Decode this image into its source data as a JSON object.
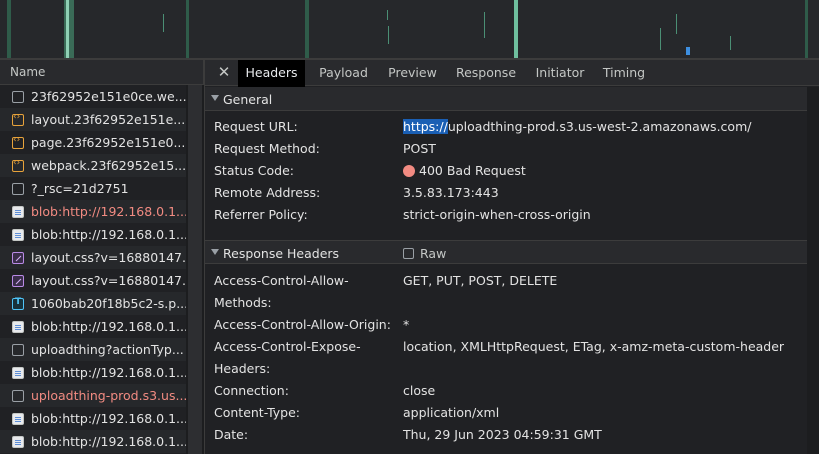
{
  "left_panel": {
    "header": "Name",
    "rows": [
      {
        "icon": "document-icon",
        "label": "23f62952e151e0ce.we...",
        "error": false
      },
      {
        "icon": "script-icon",
        "label": "layout.23f62952e151e...",
        "error": false
      },
      {
        "icon": "script-icon",
        "label": "page.23f62952e151e0...",
        "error": false
      },
      {
        "icon": "script-icon",
        "label": "webpack.23f62952e15...",
        "error": false
      },
      {
        "icon": "document-icon",
        "label": "?_rsc=21d2751",
        "error": false
      },
      {
        "icon": "blob-icon",
        "label": "blob:http://192.168.0.1...",
        "error": true
      },
      {
        "icon": "blob-icon",
        "label": "blob:http://192.168.0.1...",
        "error": false
      },
      {
        "icon": "stylesheet-icon",
        "label": "layout.css?v=16880147...",
        "error": false
      },
      {
        "icon": "stylesheet-icon",
        "label": "layout.css?v=16880147...",
        "error": false
      },
      {
        "icon": "font-icon",
        "label": "1060bab20f18b5c2-s.p...",
        "error": false
      },
      {
        "icon": "blob-icon",
        "label": "blob:http://192.168.0.1...",
        "error": false
      },
      {
        "icon": "document-icon",
        "label": "uploadthing?actionTyp...",
        "error": false
      },
      {
        "icon": "blob-icon",
        "label": "blob:http://192.168.0.1...",
        "error": false
      },
      {
        "icon": "document-icon",
        "label": "uploadthing-prod.s3.us...",
        "error": true
      },
      {
        "icon": "blob-icon",
        "label": "blob:http://192.168.0.1...",
        "error": false
      },
      {
        "icon": "blob-icon",
        "label": "blob:http://192.168.0.1...",
        "error": false
      }
    ]
  },
  "tabs": {
    "close_icon": "close-icon",
    "items": [
      "Headers",
      "Payload",
      "Preview",
      "Response",
      "Initiator",
      "Timing"
    ],
    "active": "Headers"
  },
  "general": {
    "title": "General",
    "request_url_label": "Request URL:",
    "request_url_selected": "https://",
    "request_url_rest": "uploadthing-prod.s3.us-west-2.amazonaws.com/",
    "request_method_label": "Request Method:",
    "request_method": "POST",
    "status_code_label": "Status Code:",
    "status_code": "400 Bad Request",
    "status_color": "#f28b82",
    "remote_address_label": "Remote Address:",
    "remote_address": "3.5.83.173:443",
    "referrer_policy_label": "Referrer Policy:",
    "referrer_policy": "strict-origin-when-cross-origin"
  },
  "response_headers": {
    "title": "Response Headers",
    "raw_label": "Raw",
    "raw_checked": false,
    "rows": [
      {
        "key_line1": "Access-Control-Allow-",
        "key_line2": "Methods:",
        "value": "GET, PUT, POST, DELETE"
      },
      {
        "key_line1": "Access-Control-Allow-Origin:",
        "key_line2": "",
        "value": "*"
      },
      {
        "key_line1": "Access-Control-Expose-",
        "key_line2": "Headers:",
        "value": "location, XMLHttpRequest, ETag, x-amz-meta-custom-header"
      },
      {
        "key_line1": "Connection:",
        "key_line2": "",
        "value": "close"
      },
      {
        "key_line1": "Content-Type:",
        "key_line2": "",
        "value": "application/xml"
      },
      {
        "key_line1": "Date:",
        "key_line2": "",
        "value": "Thu, 29 Jun 2023 04:59:31 GMT"
      }
    ]
  },
  "colors": {
    "accent_selection": "#1a5fb4",
    "error_text": "#f28b82"
  }
}
